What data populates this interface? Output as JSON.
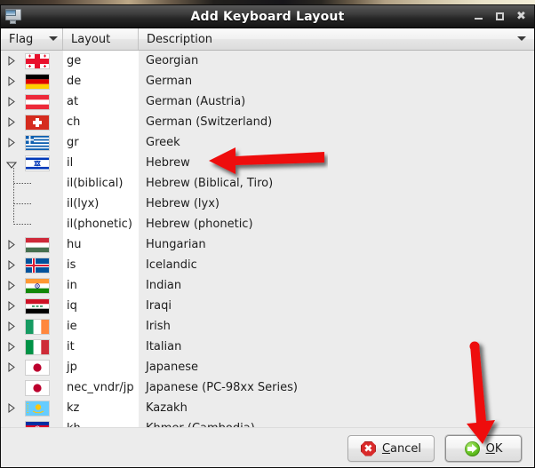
{
  "window": {
    "title": "Add Keyboard Layout",
    "icon": "monitor-icon",
    "controls": {
      "minimize": "minimize-icon",
      "maximize": "maximize-icon",
      "close": "close-icon"
    }
  },
  "columns": [
    {
      "key": "flag",
      "label": "Flag",
      "sort_indicator": "chevron-down-icon"
    },
    {
      "key": "layout",
      "label": "Layout"
    },
    {
      "key": "description",
      "label": "Description",
      "menu_indicator": "chevron-down-icon"
    }
  ],
  "rows": [
    {
      "layout": "ge",
      "description": "Georgian",
      "expander": "collapsed",
      "flag": "ge",
      "child": false
    },
    {
      "layout": "de",
      "description": "German",
      "expander": "collapsed",
      "flag": "de",
      "child": false
    },
    {
      "layout": "at",
      "description": "German (Austria)",
      "expander": "collapsed",
      "flag": "at",
      "child": false
    },
    {
      "layout": "ch",
      "description": "German (Switzerland)",
      "expander": "collapsed",
      "flag": "ch",
      "child": false
    },
    {
      "layout": "gr",
      "description": "Greek",
      "expander": "collapsed",
      "flag": "gr",
      "child": false
    },
    {
      "layout": "il",
      "description": "Hebrew",
      "expander": "expanded",
      "flag": "il",
      "child": false
    },
    {
      "layout": "il(biblical)",
      "description": "Hebrew (Biblical, Tiro)",
      "expander": "none",
      "flag": "",
      "child": true
    },
    {
      "layout": "il(lyx)",
      "description": "Hebrew (lyx)",
      "expander": "none",
      "flag": "",
      "child": true
    },
    {
      "layout": "il(phonetic)",
      "description": "Hebrew (phonetic)",
      "expander": "none",
      "flag": "",
      "child": true
    },
    {
      "layout": "hu",
      "description": "Hungarian",
      "expander": "collapsed",
      "flag": "hu",
      "child": false
    },
    {
      "layout": "is",
      "description": "Icelandic",
      "expander": "collapsed",
      "flag": "is",
      "child": false
    },
    {
      "layout": "in",
      "description": "Indian",
      "expander": "collapsed",
      "flag": "in",
      "child": false
    },
    {
      "layout": "iq",
      "description": "Iraqi",
      "expander": "collapsed",
      "flag": "iq",
      "child": false
    },
    {
      "layout": "ie",
      "description": "Irish",
      "expander": "collapsed",
      "flag": "ie",
      "child": false
    },
    {
      "layout": "it",
      "description": "Italian",
      "expander": "collapsed",
      "flag": "it",
      "child": false
    },
    {
      "layout": "jp",
      "description": "Japanese",
      "expander": "collapsed",
      "flag": "jp",
      "child": false
    },
    {
      "layout": "nec_vndr/jp",
      "description": "Japanese (PC-98xx Series)",
      "expander": "none",
      "flag": "jp",
      "child": false
    },
    {
      "layout": "kz",
      "description": "Kazakh",
      "expander": "collapsed",
      "flag": "kz",
      "child": false
    },
    {
      "layout": "kh",
      "description": "Khmer (Cambodia)",
      "expander": "none",
      "flag": "kh",
      "child": false
    }
  ],
  "buttons": {
    "cancel": {
      "label_before": "",
      "mnemonic": "C",
      "label_after": "ancel",
      "icon": "cancel-icon"
    },
    "ok": {
      "label_before": "",
      "mnemonic": "O",
      "label_after": "K",
      "icon": "ok-icon"
    }
  },
  "annotations": [
    {
      "name": "arrow-pointing-to-hebrew-row",
      "direction": "left",
      "color": "#ee1111"
    },
    {
      "name": "arrow-pointing-to-ok-button",
      "direction": "down",
      "color": "#ee1111"
    }
  ],
  "colors": {
    "titlebar": "#262626",
    "list_background": "#ececec",
    "layout_column_background": "#ffffff",
    "annotation_red": "#ee1111",
    "ok_green": "#63c121",
    "cancel_red": "#d92a2a"
  }
}
